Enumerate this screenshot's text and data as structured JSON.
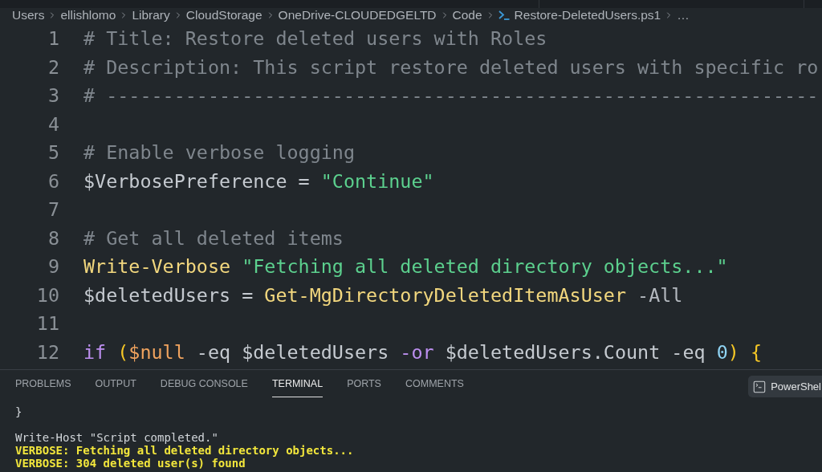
{
  "breadcrumbs": [
    {
      "label": "Users",
      "kind": "folder"
    },
    {
      "label": "ellishlomo",
      "kind": "folder"
    },
    {
      "label": "Library",
      "kind": "folder"
    },
    {
      "label": "CloudStorage",
      "kind": "folder"
    },
    {
      "label": "OneDrive-CLOUDEDGELTD",
      "kind": "folder"
    },
    {
      "label": "Code",
      "kind": "folder"
    },
    {
      "label": "Restore-DeletedUsers.ps1",
      "kind": "file"
    },
    {
      "label": "…",
      "kind": "symbols"
    }
  ],
  "editor": {
    "lines": [
      {
        "number": "1",
        "tokens": [
          {
            "kind": "comment",
            "text": "# Title: Restore deleted users with Roles"
          }
        ]
      },
      {
        "number": "2",
        "tokens": [
          {
            "kind": "comment",
            "text": "# Description: This script restore deleted users with specific ro"
          }
        ]
      },
      {
        "number": "3",
        "tokens": [
          {
            "kind": "comment",
            "text": "# ---------------------------------------------------------------"
          }
        ]
      },
      {
        "number": "4"
      },
      {
        "number": "5",
        "tokens": [
          {
            "kind": "comment",
            "text": "# Enable verbose logging"
          }
        ]
      },
      {
        "number": "6",
        "tokens": [
          {
            "kind": "variable",
            "text": "$VerbosePreference"
          },
          {
            "kind": "plain",
            "text": " = "
          },
          {
            "kind": "string",
            "text": "\"Continue\""
          }
        ]
      },
      {
        "number": "7"
      },
      {
        "number": "8",
        "tokens": [
          {
            "kind": "comment",
            "text": "# Get all deleted items"
          }
        ]
      },
      {
        "number": "9",
        "tokens": [
          {
            "kind": "function",
            "text": "Write-Verbose "
          },
          {
            "kind": "string",
            "text": "\"Fetching all deleted directory objects...\""
          }
        ]
      },
      {
        "number": "10",
        "tokens": [
          {
            "kind": "variable",
            "text": "$deletedUsers"
          },
          {
            "kind": "plain",
            "text": " = "
          },
          {
            "kind": "function",
            "text": "Get-MgDirectoryDeletedItemAsUser"
          },
          {
            "kind": "parameter",
            "text": " -All"
          }
        ]
      },
      {
        "number": "11"
      },
      {
        "number": "12",
        "tokens": [
          {
            "kind": "keyword",
            "text": "if "
          },
          {
            "kind": "bracket",
            "text": "("
          },
          {
            "kind": "constant",
            "text": "$null"
          },
          {
            "kind": "plain",
            "text": " -eq $deletedUsers "
          },
          {
            "kind": "keyword",
            "text": "-or"
          },
          {
            "kind": "plain",
            "text": " $deletedUsers.Count -eq "
          },
          {
            "kind": "number",
            "text": "0"
          },
          {
            "kind": "bracket",
            "text": ") {"
          }
        ]
      }
    ]
  },
  "panel": {
    "tabs": [
      {
        "label": "PROBLEMS",
        "selected": false
      },
      {
        "label": "OUTPUT",
        "selected": false
      },
      {
        "label": "DEBUG CONSOLE",
        "selected": false
      },
      {
        "label": "TERMINAL",
        "selected": true
      },
      {
        "label": "PORTS",
        "selected": false
      },
      {
        "label": "COMMENTS",
        "selected": false
      }
    ],
    "terminal_profile": {
      "label": "PowerShel"
    },
    "terminal_lines": [
      {
        "kind": "output",
        "text": "}"
      },
      {
        "kind": "blank"
      },
      {
        "kind": "output",
        "text": "Write-Host \"Script completed.\""
      },
      {
        "kind": "verbose",
        "text": "VERBOSE: Fetching all deleted directory objects..."
      },
      {
        "kind": "verbose",
        "text": "VERBOSE: 304 deleted user(s) found"
      }
    ]
  }
}
